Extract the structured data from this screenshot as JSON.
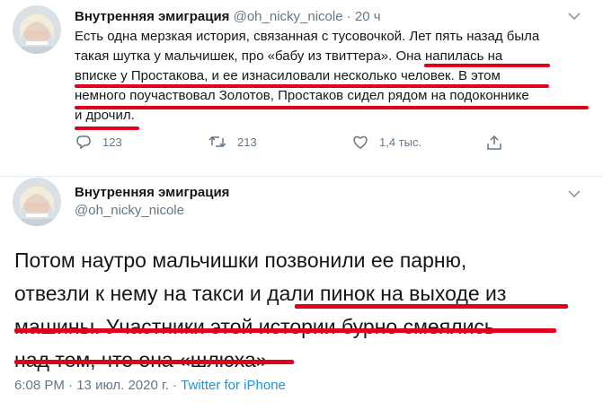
{
  "tweet1": {
    "display_name": "Внутренняя эмиграция",
    "handle": "@oh_nicky_nicole",
    "separator": "·",
    "age": "20 ч",
    "lines": [
      "Есть одна мерзкая история, связанная с тусовочкой. Лет пять назад была",
      "такая шутка у мальчишек, про «бабу из твиттера». Она напилась на",
      "вписке у Простакова, и ее изнасиловали несколько человек. В этом",
      "немного поучаствовал Золотов, Простаков сидел рядом на подоконнике",
      "и дрочил."
    ],
    "replies": "123",
    "retweets": "213",
    "likes": "1,4 тыс."
  },
  "tweet2": {
    "display_name": "Внутренняя эмиграция",
    "handle": "@oh_nicky_nicole",
    "lines": [
      "Потом наутро мальчишки позвонили ее парню,",
      "отвезли к нему на такси и дали пинок на выходе из",
      "машины. Участники этой истории бурно смеялись",
      "над тем, что она «шлюха»"
    ],
    "time": "6:08 PM",
    "date": "13 июл. 2020 г.",
    "separator": "·",
    "source": "Twitter for iPhone"
  },
  "icons": {
    "reply": "reply-icon",
    "retweet": "retweet-icon",
    "like": "heart-icon",
    "share": "share-icon",
    "menu": "chevron-down-icon"
  },
  "colors": {
    "underline": "#e0001b",
    "link": "#1b95e0",
    "muted": "#657786"
  }
}
